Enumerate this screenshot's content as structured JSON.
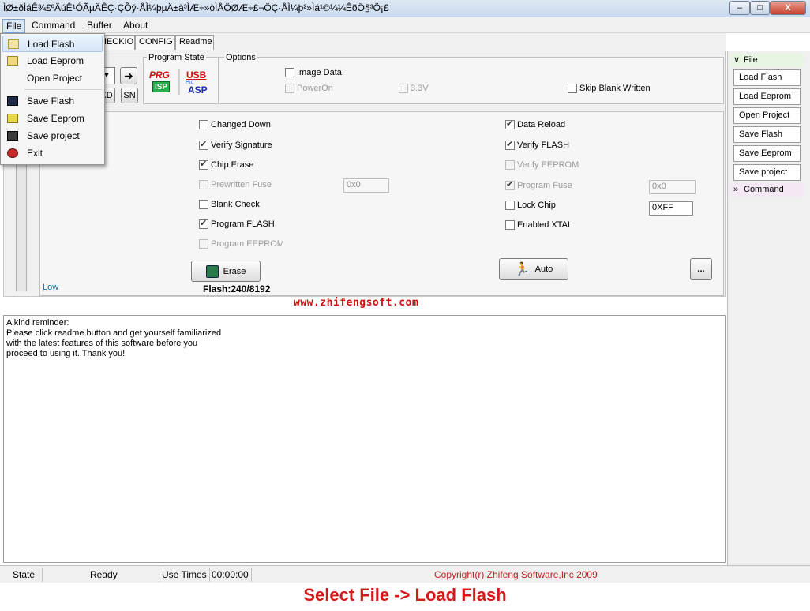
{
  "window": {
    "title": "ÌØ±ðÌáÊ¾£ºÄúÊ¹ÓÃµÄÊÇ·ÇÕý·ÅÌ¼þµÄ±à³ÌÆ÷»òÌÅÖØÆ÷£¬ÖÇ·ÅÌ¼þ²»Ìá¹©¼¼ÊõÖ§³Ö¡£",
    "min_label": "–",
    "max_label": "□",
    "close_label": "X"
  },
  "menubar": {
    "items": [
      "File",
      "Command",
      "Buffer",
      "About"
    ]
  },
  "file_menu": {
    "items": [
      "Load Flash",
      "Load Eeprom",
      "Open Project",
      "Save Flash",
      "Save Eeprom",
      "Save project",
      "Exit"
    ],
    "highlighted": "Load Flash"
  },
  "tabs": {
    "partial": "HECKIO",
    "config": "CONFIG",
    "readme": "Readme"
  },
  "left_buttons": {
    "xd": "XD",
    "sn": "SN"
  },
  "program_state": {
    "title": "Program State",
    "prg": "PRG",
    "isp": "ISP",
    "usb": "USB",
    "asp": "ASP",
    "usb_small": "Hid"
  },
  "options": {
    "title": "Options",
    "image_data": {
      "label": "Image Data",
      "checked": false
    },
    "power_on": {
      "label": "PowerOn",
      "checked": false
    },
    "v33": {
      "label": "3.3V",
      "checked": false
    },
    "skip_blank": {
      "label": "Skip Blank Written",
      "checked": false
    }
  },
  "checks_left": [
    {
      "label": "Changed Down",
      "checked": false,
      "enabled": true
    },
    {
      "label": "Verify Signature",
      "checked": true,
      "enabled": true
    },
    {
      "label": "Chip Erase",
      "checked": true,
      "enabled": true
    },
    {
      "label": "Prewritten Fuse",
      "checked": false,
      "enabled": false
    },
    {
      "label": "Blank Check",
      "checked": false,
      "enabled": true
    },
    {
      "label": "Program FLASH",
      "checked": true,
      "enabled": true
    },
    {
      "label": "Program EEPROM",
      "checked": false,
      "enabled": false
    }
  ],
  "checks_right": [
    {
      "label": "Data Reload",
      "checked": true,
      "enabled": true
    },
    {
      "label": "Verify FLASH",
      "checked": true,
      "enabled": true
    },
    {
      "label": "Verify EEPROM",
      "checked": false,
      "enabled": false
    },
    {
      "label": "Program Fuse",
      "checked": true,
      "enabled": false
    },
    {
      "label": "Lock Chip",
      "checked": false,
      "enabled": true
    },
    {
      "label": "Enabled XTAL",
      "checked": false,
      "enabled": true
    }
  ],
  "fields": {
    "prewritten_fuse": "0x0",
    "program_fuse": "0x0",
    "lock_chip": "0XFF"
  },
  "buttons": {
    "erase": "Erase",
    "auto": "Auto",
    "more": "..."
  },
  "flash_info": "Flash:240/8192",
  "slider_low": "Low",
  "website": "www.zhifengsoft.com",
  "log_lines": [
    "A kind reminder:",
    "Please click readme button and get yourself familiarized",
    "with the latest features of this software before you",
    "proceed to using it. Thank you!"
  ],
  "side_panel": {
    "file_header": "File",
    "buttons": [
      "Load Flash",
      "Load Eeprom",
      "Open Project",
      "Save Flash",
      "Save Eeprom",
      "Save project"
    ],
    "command_header": "Command"
  },
  "statusbar": {
    "state": "State",
    "ready": "Ready",
    "use_times_label": "Use Times",
    "use_times_value": "00:00:00",
    "copyright": "Copyright(r) Zhifeng Software,Inc 2009"
  },
  "caption": "Select  File -> Load Flash",
  "colors": {
    "caption": "#d11b1b",
    "website": "#cc1111",
    "copyright": "#c02020"
  }
}
